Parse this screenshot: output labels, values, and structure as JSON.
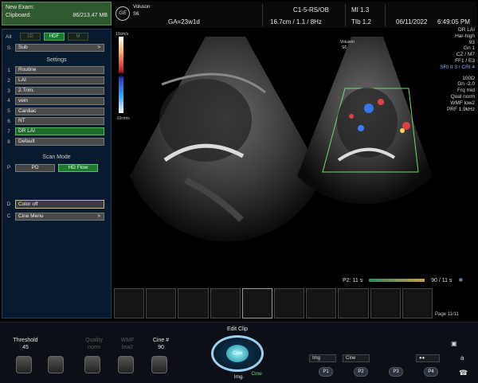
{
  "status": {
    "label1": "New Exam:",
    "label2": "Clipboard:",
    "clipboard_value": "86/213.47 MB"
  },
  "header": {
    "logo_brand": "Voluson",
    "model": "S6",
    "probe": "C1-5-RS/OB",
    "mi": "MI  1.3",
    "ga": "GA=23w1d",
    "depth": "16.7cm / 1.1 / 8Hz",
    "tib": "TIb  1.2",
    "date": "06/11/2022",
    "time": "6:49:05 PM"
  },
  "left_panel": {
    "alt_label": "Alt",
    "alt_buttons": [
      "2D",
      "HDF",
      "M"
    ],
    "sub_key": "S",
    "sub_label": "Sub",
    "settings_title": "Settings",
    "settings": [
      {
        "key": "1",
        "label": "Routine"
      },
      {
        "key": "2",
        "label": "LAI"
      },
      {
        "key": "3",
        "label": "2.Trim."
      },
      {
        "key": "4",
        "label": "vein"
      },
      {
        "key": "5",
        "label": "Cardiac"
      },
      {
        "key": "6",
        "label": "NT"
      },
      {
        "key": "7",
        "label": "DR LAI"
      },
      {
        "key": "8",
        "label": "Default"
      }
    ],
    "scan_mode_title": "Scan Mode",
    "scan_key": "P",
    "scan_pd": "PD",
    "scan_hdflow": "HD Flow",
    "color_key": "D",
    "color_off": "Color off",
    "cine_key": "C",
    "cine_menu": "Cine Menu"
  },
  "image": {
    "scale_top": "10cm/s",
    "scale_bottom": "-10cm/s",
    "mini_brand": "Voluson",
    "mini_model": "S6"
  },
  "params": {
    "block1": [
      "DR LAI",
      "Har-high",
      "93",
      "Gn   1",
      "CZ / M7",
      "FF1 / E3"
    ],
    "highlight": "SRI II 3 / CRI 4",
    "block2": [
      "100Ω",
      "Gn -2.0",
      "Frq mid",
      "Qual norm",
      "WMF low2",
      "PRF  1.9kHz"
    ]
  },
  "cine": {
    "p2": "P2:",
    "start": "11 s",
    "end": "90 / 11 s",
    "page": "Page 11/11"
  },
  "bottom": {
    "threshold_label": "Threshold",
    "threshold_value": "45",
    "quality_label": "Quality",
    "quality_value": "norm",
    "wmf_label": "WMF",
    "wmf_value": "low2",
    "cine_label": "Cine #",
    "cine_value": "90",
    "edit_clip": "Edit Clip",
    "dial_label": "Cine",
    "img_label": "Img.",
    "cine_sel": "Cine",
    "img_btn": "Img",
    "cine_btn": "Cine",
    "p_buttons": [
      "P1",
      "P2",
      "P3",
      "P4"
    ],
    "letter": "a"
  },
  "colors": {
    "accent_green": "#1f7a2e",
    "panel_blue": "#081a2e",
    "doppler_red": "#e04040",
    "doppler_blue": "#3a7bff"
  }
}
